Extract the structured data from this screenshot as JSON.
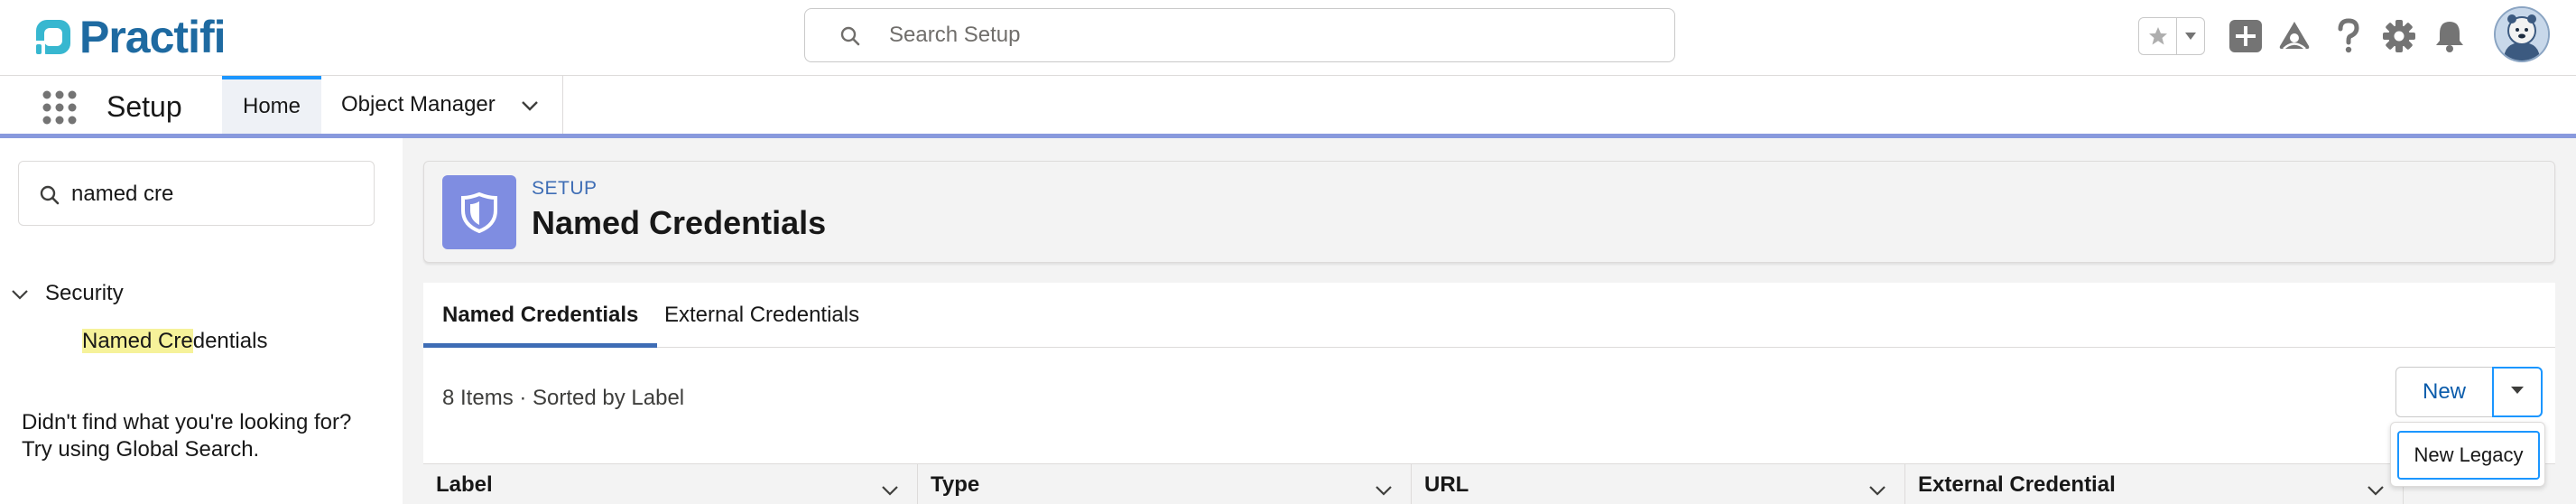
{
  "header": {
    "logo_text": "Practifi",
    "search": {
      "placeholder": "Search Setup",
      "value": ""
    }
  },
  "context_bar": {
    "app_name": "Setup",
    "tabs": [
      {
        "label": "Home",
        "active": true
      },
      {
        "label": "Object Manager",
        "active": false
      }
    ]
  },
  "sidebar": {
    "quick_find_value": "named cre",
    "tree": {
      "parent_label": "Security",
      "child_highlight": "Named Cre",
      "child_rest": "dentials"
    },
    "help_line1": "Didn't find what you're looking for?",
    "help_line2": "Try using Global Search."
  },
  "page_header": {
    "eyebrow": "SETUP",
    "title": "Named Credentials"
  },
  "content": {
    "tabs": [
      {
        "label": "Named Credentials",
        "active": true
      },
      {
        "label": "External Credentials",
        "active": false
      }
    ],
    "list_info": "8 Items · Sorted by Label",
    "new_button": "New",
    "menu_item": "New Legacy",
    "columns": [
      "Label",
      "Type",
      "URL",
      "External Credential"
    ]
  },
  "colors": {
    "brand": "#1e6aa1",
    "accent": "#1b96ff",
    "header_icon_bg": "#7f8de1",
    "link": "#0b5cab"
  }
}
